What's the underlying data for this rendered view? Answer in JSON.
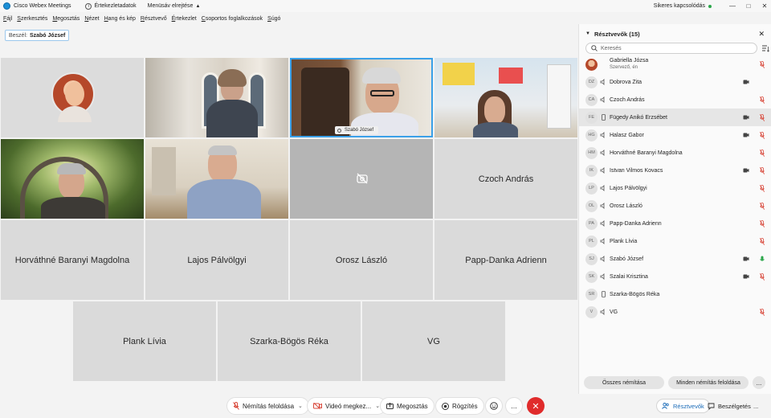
{
  "window": {
    "app_title": "Cisco Webex Meetings",
    "meeting_info_label": "Értekezletadatok",
    "menubar_toggle_label": "Menüsáv elrejtése",
    "connection_status": "Sikeres kapcsolódás",
    "connection_color": "#2aa64a"
  },
  "menu": [
    "Fájl",
    "Szerkesztés",
    "Megosztás",
    "Nézet",
    "Hang és kép",
    "Résztvevő",
    "Értekezlet",
    "Csoportos foglalkozások",
    "Súgó"
  ],
  "speaker": {
    "label": "Beszél:",
    "name": "Szabó József"
  },
  "video_tiles": [
    {
      "kind": "avatar",
      "name": ""
    },
    {
      "kind": "video",
      "name": ""
    },
    {
      "kind": "video",
      "name": "Szabó József",
      "active": true
    },
    {
      "kind": "video",
      "name": ""
    },
    {
      "kind": "video",
      "name": ""
    },
    {
      "kind": "video",
      "name": ""
    },
    {
      "kind": "camera-off",
      "name": ""
    },
    {
      "kind": "name",
      "name": "Czoch András"
    },
    {
      "kind": "name",
      "name": "Horváthné Baranyi Magdolna"
    },
    {
      "kind": "name",
      "name": "Lajos Pálvölgyi"
    },
    {
      "kind": "name",
      "name": "Orosz László"
    },
    {
      "kind": "name",
      "name": "Papp-Danka Adrienn"
    },
    {
      "kind": "name",
      "name": "Plank Lívia"
    },
    {
      "kind": "name",
      "name": "Szarka-Bögös Réka"
    },
    {
      "kind": "name",
      "name": "VG"
    }
  ],
  "toolbar": {
    "unmute": "Némítás feloldása",
    "stop_video": "Videó megkez...",
    "share": "Megosztás",
    "record": "Rögzítés",
    "more": "...",
    "end_color": "#e02b2b"
  },
  "panel": {
    "title": "Résztvevők (15)",
    "search_placeholder": "Keresés",
    "participants": [
      {
        "initials": "",
        "name": "Gabriella Józsa",
        "sub": "Szervező, én",
        "cam": false,
        "mic": "muted",
        "photo": true
      },
      {
        "initials": "DZ",
        "name": "Dobrova Zita",
        "sub": "",
        "cam": true,
        "mic": "none",
        "device": "computer"
      },
      {
        "initials": "CA",
        "name": "Czoch András",
        "sub": "",
        "cam": false,
        "mic": "muted",
        "device": "computer"
      },
      {
        "initials": "FE",
        "name": "Fügedy Anikó Erzsébet",
        "sub": "",
        "cam": true,
        "mic": "muted",
        "device": "phone",
        "selected": true
      },
      {
        "initials": "HG",
        "name": "Halasz Gabor",
        "sub": "",
        "cam": true,
        "mic": "muted",
        "device": "computer"
      },
      {
        "initials": "HM",
        "name": "Horváthné Baranyi Magdolna",
        "sub": "",
        "cam": false,
        "mic": "muted",
        "device": "computer"
      },
      {
        "initials": "IK",
        "name": "Istvan Vilmos Kovacs",
        "sub": "",
        "cam": true,
        "mic": "muted",
        "device": "computer"
      },
      {
        "initials": "LP",
        "name": "Lajos Pálvölgyi",
        "sub": "",
        "cam": false,
        "mic": "muted",
        "device": "computer"
      },
      {
        "initials": "OL",
        "name": "Orosz László",
        "sub": "",
        "cam": false,
        "mic": "muted",
        "device": "computer"
      },
      {
        "initials": "PA",
        "name": "Papp-Danka Adrienn",
        "sub": "",
        "cam": false,
        "mic": "muted",
        "device": "computer"
      },
      {
        "initials": "PL",
        "name": "Plank Lívia",
        "sub": "",
        "cam": false,
        "mic": "muted",
        "device": "computer"
      },
      {
        "initials": "SJ",
        "name": "Szabó József",
        "sub": "",
        "cam": true,
        "mic": "active",
        "device": "computer"
      },
      {
        "initials": "SK",
        "name": "Szalai Krisztina",
        "sub": "",
        "cam": true,
        "mic": "muted",
        "device": "computer"
      },
      {
        "initials": "SR",
        "name": "Szarka-Bögös Réka",
        "sub": "",
        "cam": false,
        "mic": "none",
        "device": "phone"
      },
      {
        "initials": "V",
        "name": "VG",
        "sub": "",
        "cam": false,
        "mic": "muted",
        "device": "computer"
      }
    ],
    "mute_all": "Összes némítása",
    "unmute_all": "Minden némítás feloldása",
    "more": "..."
  },
  "bottom_tabs": {
    "participants": "Résztvevők",
    "chat": "Beszélgetés",
    "more": "..."
  },
  "colors": {
    "muted_mic": "#d9483b",
    "active_mic": "#2aa64a",
    "active_tile_border": "#3aa0e8",
    "accent": "#1a6bb8"
  }
}
